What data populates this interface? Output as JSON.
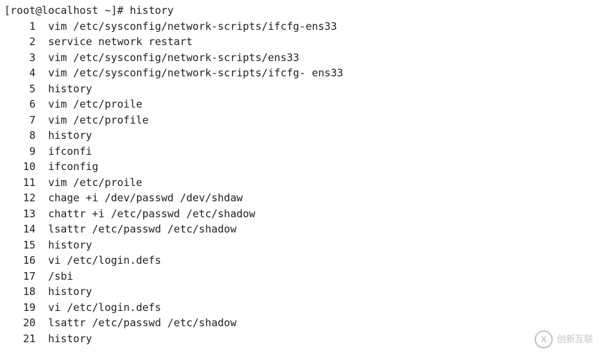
{
  "prompt": "[root@localhost ~]# history",
  "history": [
    {
      "n": "1",
      "cmd": "vim /etc/sysconfig/network-scripts/ifcfg-ens33"
    },
    {
      "n": "2",
      "cmd": "service network restart"
    },
    {
      "n": "3",
      "cmd": "vim /etc/sysconfig/network-scripts/ens33"
    },
    {
      "n": "4",
      "cmd": "vim /etc/sysconfig/network-scripts/ifcfg- ens33"
    },
    {
      "n": "5",
      "cmd": "history"
    },
    {
      "n": "6",
      "cmd": "vim /etc/proile"
    },
    {
      "n": "7",
      "cmd": "vim /etc/profile"
    },
    {
      "n": "8",
      "cmd": "history"
    },
    {
      "n": "9",
      "cmd": "ifconfi"
    },
    {
      "n": "10",
      "cmd": "ifconfig"
    },
    {
      "n": "11",
      "cmd": "vim /etc/proile"
    },
    {
      "n": "12",
      "cmd": "chage +i /dev/passwd /dev/shdaw"
    },
    {
      "n": "13",
      "cmd": "chattr +i /etc/passwd /etc/shadow"
    },
    {
      "n": "14",
      "cmd": "lsattr /etc/passwd /etc/shadow"
    },
    {
      "n": "15",
      "cmd": "history"
    },
    {
      "n": "16",
      "cmd": "vi /etc/login.defs"
    },
    {
      "n": "17",
      "cmd": "/sbi"
    },
    {
      "n": "18",
      "cmd": "history"
    },
    {
      "n": "19",
      "cmd": "vi /etc/login.defs"
    },
    {
      "n": "20",
      "cmd": "lsattr /etc/passwd /etc/shadow"
    },
    {
      "n": "21",
      "cmd": "history"
    }
  ],
  "watermark": {
    "text": "创新互联",
    "iconLetter": "X"
  }
}
